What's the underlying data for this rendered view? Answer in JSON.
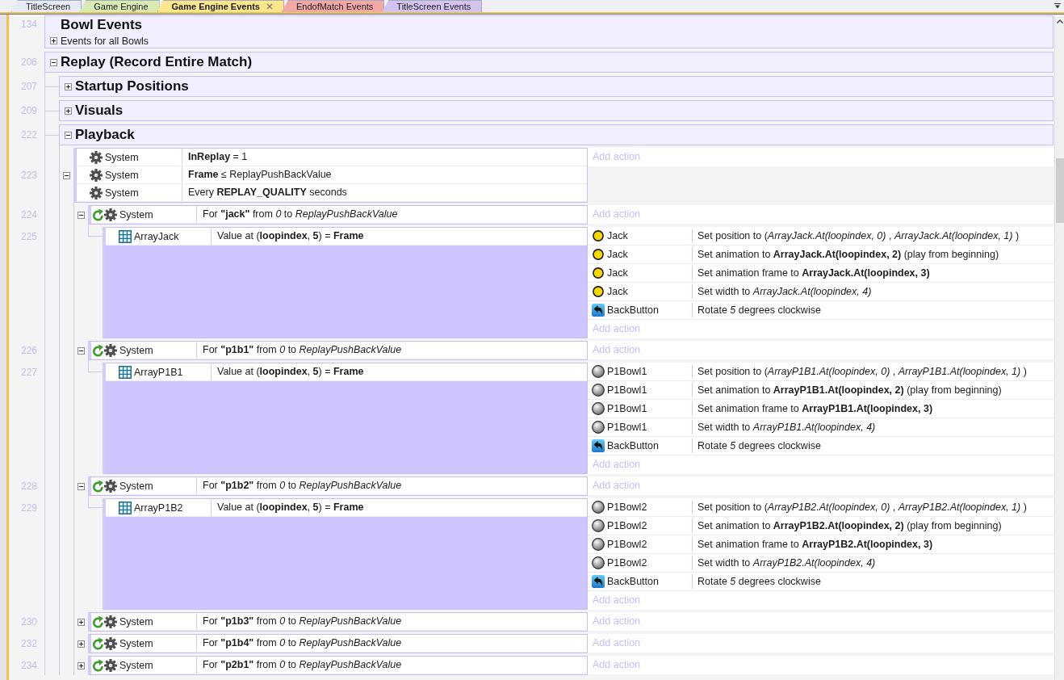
{
  "tabs": [
    {
      "label": "TitleScreen",
      "color": "#e6ebf5",
      "selected": false
    },
    {
      "label": "Game Engine",
      "color": "#d8e9b2",
      "selected": false
    },
    {
      "label": "Game Engine Events",
      "color": "#fde78c",
      "selected": true
    },
    {
      "label": "EndofMatch Events",
      "color": "#f4a7a7",
      "selected": false
    },
    {
      "label": "TitleScreen Events",
      "color": "#d2c3f0",
      "selected": false
    }
  ],
  "sheet": {
    "rows": [
      {
        "kind": "group",
        "line": "134",
        "title": "Bowl Events",
        "description": "Events for all Bowls",
        "expanded": false
      },
      {
        "kind": "group",
        "line": "206",
        "title": "Replay (Record Entire Match)",
        "expanded": true,
        "children": [
          {
            "kind": "group",
            "line": "207",
            "title": "Startup Positions",
            "expanded": false
          },
          {
            "kind": "group",
            "line": "209",
            "title": "Visuals",
            "expanded": false
          },
          {
            "kind": "group",
            "line": "222",
            "title": "Playback",
            "expanded": true,
            "children": [
              {
                "kind": "event",
                "line": "223",
                "expanded": true,
                "conditions": [
                  {
                    "kind": "system",
                    "object": "System",
                    "text": "**InReplay** = 1"
                  },
                  {
                    "kind": "system",
                    "object": "System",
                    "text": "**Frame** ≤ ReplayPushBackValue"
                  },
                  {
                    "kind": "system",
                    "object": "System",
                    "text": "Every **REPLAY_QUALITY** seconds"
                  }
                ],
                "add_action": "Add action",
                "children": [
                  {
                    "kind": "event",
                    "line": "224",
                    "expanded": true,
                    "conditions": [
                      {
                        "kind": "loop",
                        "object": "System",
                        "text": "For **\"jack\"** from *0* to *ReplayPushBackValue*"
                      }
                    ],
                    "add_action": "Add action",
                    "children": [
                      {
                        "kind": "event",
                        "line": "225",
                        "conditions": [
                          {
                            "kind": "array",
                            "object": "ArrayJack",
                            "text": "Value at (**loopindex**, **5**) = **Frame**"
                          }
                        ],
                        "actions": [
                          {
                            "kind": "disc",
                            "object": "Jack",
                            "text": "Set position to (*ArrayJack.At(loopindex, 0)* , *ArrayJack.At(loopindex, 1)* )"
                          },
                          {
                            "kind": "disc",
                            "object": "Jack",
                            "text": "Set animation to **ArrayJack.At(loopindex, 2)** (play from beginning)"
                          },
                          {
                            "kind": "disc",
                            "object": "Jack",
                            "text": "Set animation frame to **ArrayJack.At(loopindex, 3)**"
                          },
                          {
                            "kind": "disc",
                            "object": "Jack",
                            "text": "Set width to *ArrayJack.At(loopindex, 4)*"
                          },
                          {
                            "kind": "tile",
                            "object": "BackButton",
                            "text": "Rotate *5* degrees clockwise"
                          }
                        ],
                        "add_action": "Add action"
                      }
                    ]
                  },
                  {
                    "kind": "event",
                    "line": "226",
                    "expanded": true,
                    "conditions": [
                      {
                        "kind": "loop",
                        "object": "System",
                        "text": "For **\"p1b1\"** from *0* to *ReplayPushBackValue*"
                      }
                    ],
                    "add_action": "Add action",
                    "children": [
                      {
                        "kind": "event",
                        "line": "227",
                        "conditions": [
                          {
                            "kind": "array",
                            "object": "ArrayP1B1",
                            "text": "Value at (**loopindex**, **5**) = **Frame**"
                          }
                        ],
                        "actions": [
                          {
                            "kind": "sphere",
                            "object": "P1Bowl1",
                            "text": "Set position to (*ArrayP1B1.At(loopindex, 0)* , *ArrayP1B1.At(loopindex, 1)* )"
                          },
                          {
                            "kind": "sphere",
                            "object": "P1Bowl1",
                            "text": "Set animation to **ArrayP1B1.At(loopindex, 2)** (play from beginning)"
                          },
                          {
                            "kind": "sphere",
                            "object": "P1Bowl1",
                            "text": "Set animation frame to **ArrayP1B1.At(loopindex, 3)**"
                          },
                          {
                            "kind": "sphere",
                            "object": "P1Bowl1",
                            "text": "Set width to *ArrayP1B1.At(loopindex, 4)*"
                          },
                          {
                            "kind": "tile",
                            "object": "BackButton",
                            "text": "Rotate *5* degrees clockwise"
                          }
                        ],
                        "add_action": "Add action"
                      }
                    ]
                  },
                  {
                    "kind": "event",
                    "line": "228",
                    "expanded": true,
                    "conditions": [
                      {
                        "kind": "loop",
                        "object": "System",
                        "text": "For **\"p1b2\"** from *0* to *ReplayPushBackValue*"
                      }
                    ],
                    "add_action": "Add action",
                    "children": [
                      {
                        "kind": "event",
                        "line": "229",
                        "conditions": [
                          {
                            "kind": "array",
                            "object": "ArrayP1B2",
                            "text": "Value at (**loopindex**, **5**) = **Frame**"
                          }
                        ],
                        "actions": [
                          {
                            "kind": "sphere",
                            "object": "P1Bowl2",
                            "text": "Set position to (*ArrayP1B2.At(loopindex, 0)* , *ArrayP1B2.At(loopindex, 1)* )"
                          },
                          {
                            "kind": "sphere",
                            "object": "P1Bowl2",
                            "text": "Set animation to **ArrayP1B2.At(loopindex, 2)** (play from beginning)"
                          },
                          {
                            "kind": "sphere",
                            "object": "P1Bowl2",
                            "text": "Set animation frame to **ArrayP1B2.At(loopindex, 3)**"
                          },
                          {
                            "kind": "sphere",
                            "object": "P1Bowl2",
                            "text": "Set width to *ArrayP1B2.At(loopindex, 4)*"
                          },
                          {
                            "kind": "tile",
                            "object": "BackButton",
                            "text": "Rotate *5* degrees clockwise"
                          }
                        ],
                        "add_action": "Add action"
                      }
                    ]
                  },
                  {
                    "kind": "event",
                    "line": "230",
                    "expanded": false,
                    "conditions": [
                      {
                        "kind": "loop",
                        "object": "System",
                        "text": "For **\"p1b3\"** from *0* to *ReplayPushBackValue*"
                      }
                    ],
                    "add_action": "Add action"
                  },
                  {
                    "kind": "event",
                    "line": "232",
                    "expanded": false,
                    "conditions": [
                      {
                        "kind": "loop",
                        "object": "System",
                        "text": "For **\"p1b4\"** from *0* to *ReplayPushBackValue*"
                      }
                    ],
                    "add_action": "Add action"
                  },
                  {
                    "kind": "event",
                    "line": "234",
                    "expanded": false,
                    "conditions": [
                      {
                        "kind": "loop",
                        "object": "System",
                        "text": "For **\"p2b1\"** from *0* to *ReplayPushBackValue*"
                      }
                    ],
                    "add_action": "Add action"
                  }
                ]
              }
            ]
          }
        ]
      }
    ]
  }
}
